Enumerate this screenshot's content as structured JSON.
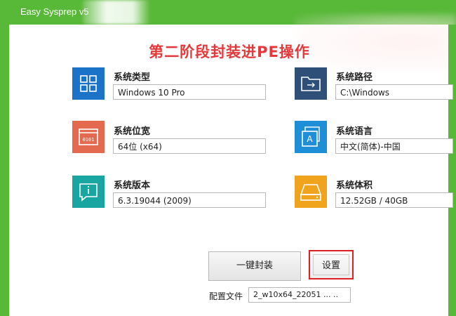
{
  "window": {
    "title": "Easy Sysprep v5"
  },
  "stage_title": "第二阶段封装进PE操作",
  "info": {
    "system_type": {
      "label": "系统类型",
      "value": "Windows 10 Pro",
      "icon": "grid-icon",
      "color": "#1a73c7"
    },
    "system_bits": {
      "label": "系统位宽",
      "value": "64位 (x64)",
      "icon": "binary-window-icon",
      "color": "#e36a4e"
    },
    "system_version": {
      "label": "系统版本",
      "value": "6.3.19044 (2009)",
      "icon": "info-chat-icon",
      "color": "#1aa6a0"
    },
    "system_path": {
      "label": "系统路径",
      "value": "C:\\Windows",
      "icon": "folder-arrow-icon",
      "color": "#2d4f78"
    },
    "system_language": {
      "label": "系统语言",
      "value": "中文(简体)-中国",
      "icon": "language-icon",
      "color": "#1e8fd6"
    },
    "system_size": {
      "label": "系统体积",
      "value": "12.52GB / 40GB",
      "icon": "disk-drive-icon",
      "color": "#f0a31c"
    }
  },
  "buttons": {
    "one_click_package": "一键封装",
    "settings": "设置"
  },
  "config": {
    "label": "配置文件",
    "value": "2_w10x64_22051 ...  .."
  },
  "colors": {
    "titlebar": "#58b838",
    "stage_title": "#e5383b",
    "highlight": "#e02020"
  }
}
